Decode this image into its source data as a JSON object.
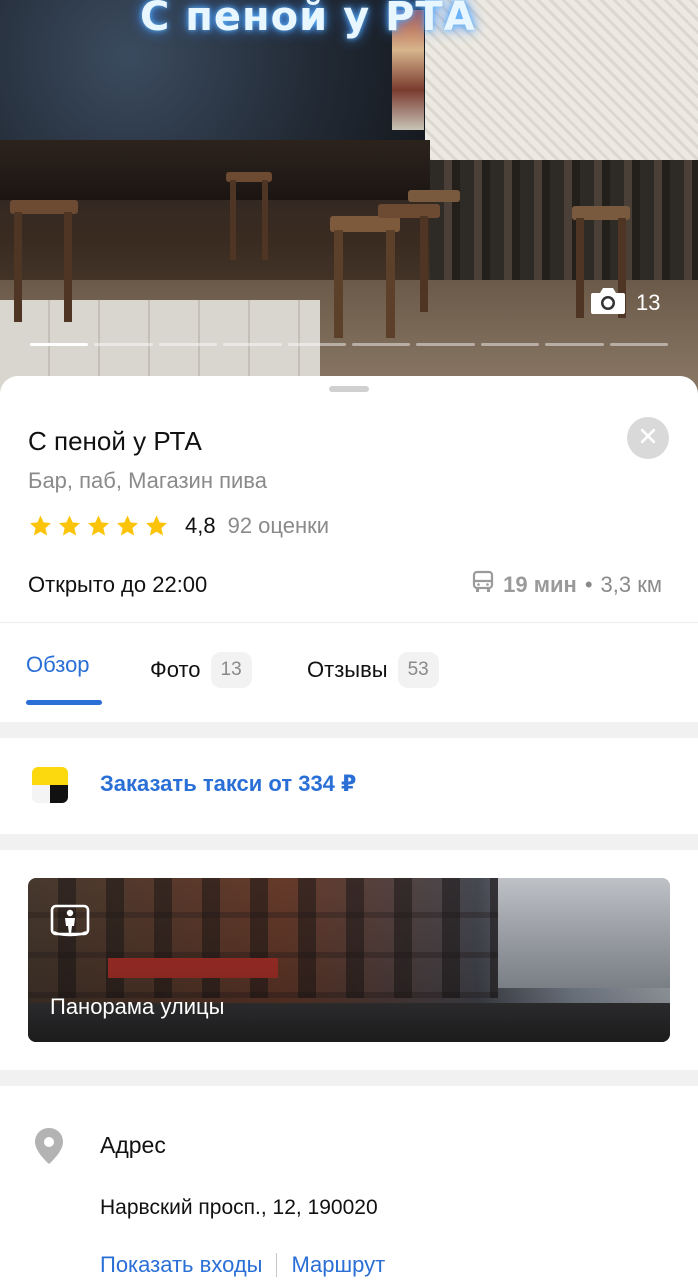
{
  "hero": {
    "neon_sign": "С пеной у РТА",
    "photo_count": "13",
    "slides_total": 10,
    "slide_active": 1
  },
  "place": {
    "name": "С пеной у РТА",
    "category": "Бар, паб, Магазин пива",
    "rating_value": "4,8",
    "rating_stars": 5,
    "rating_count": "92 оценки",
    "hours": "Открыто до 22:00",
    "route_time": "19 мин",
    "route_separator": "•",
    "route_distance": "3,3 км"
  },
  "tabs": [
    {
      "label": "Обзор",
      "active": true
    },
    {
      "label": "Фото",
      "badge": "13"
    },
    {
      "label": "Отзывы",
      "badge": "53"
    }
  ],
  "taxi": {
    "label": "Заказать такси от 334 ₽"
  },
  "panorama": {
    "label": "Панорама улицы"
  },
  "address": {
    "title": "Адрес",
    "value": "Нарвский просп., 12, 190020",
    "show_entrances": "Показать входы",
    "route": "Маршрут"
  },
  "colors": {
    "accent": "#2a6fd6",
    "star": "#fcc30b",
    "taxi_yellow": "#fcd80e"
  },
  "icons": {
    "camera": "camera-icon",
    "close": "close-icon",
    "star": "star-icon",
    "bus": "bus-icon",
    "taxi": "taxi-logo-icon",
    "panorama": "panorama-icon",
    "pin": "location-pin-icon"
  }
}
